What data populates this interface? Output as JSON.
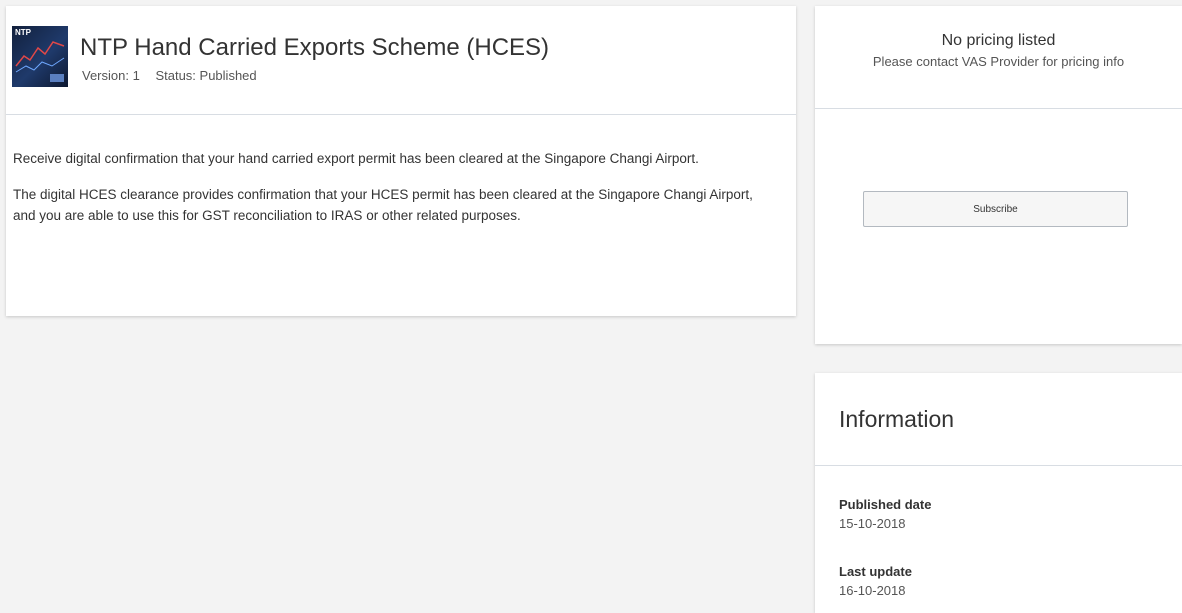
{
  "service": {
    "logo_text": "NTP",
    "title": "NTP Hand Carried Exports Scheme (HCES)",
    "version_text": "Version: 1",
    "status_text": "Status: Published",
    "description": [
      "Receive digital confirmation that your hand carried export permit has been cleared at the Singapore Changi Airport.",
      "The digital HCES clearance provides confirmation that your HCES permit has been cleared at the Singapore Changi Airport, and you are able to use this for GST reconciliation to IRAS or other related purposes."
    ]
  },
  "pricing": {
    "title": "No pricing listed",
    "subtitle": "Please contact VAS Provider for pricing info",
    "subscribe_label": "Subscribe"
  },
  "information": {
    "heading": "Information",
    "published_label": "Published date",
    "published_value": "15-10-2018",
    "updated_label": "Last update",
    "updated_value": "16-10-2018"
  }
}
